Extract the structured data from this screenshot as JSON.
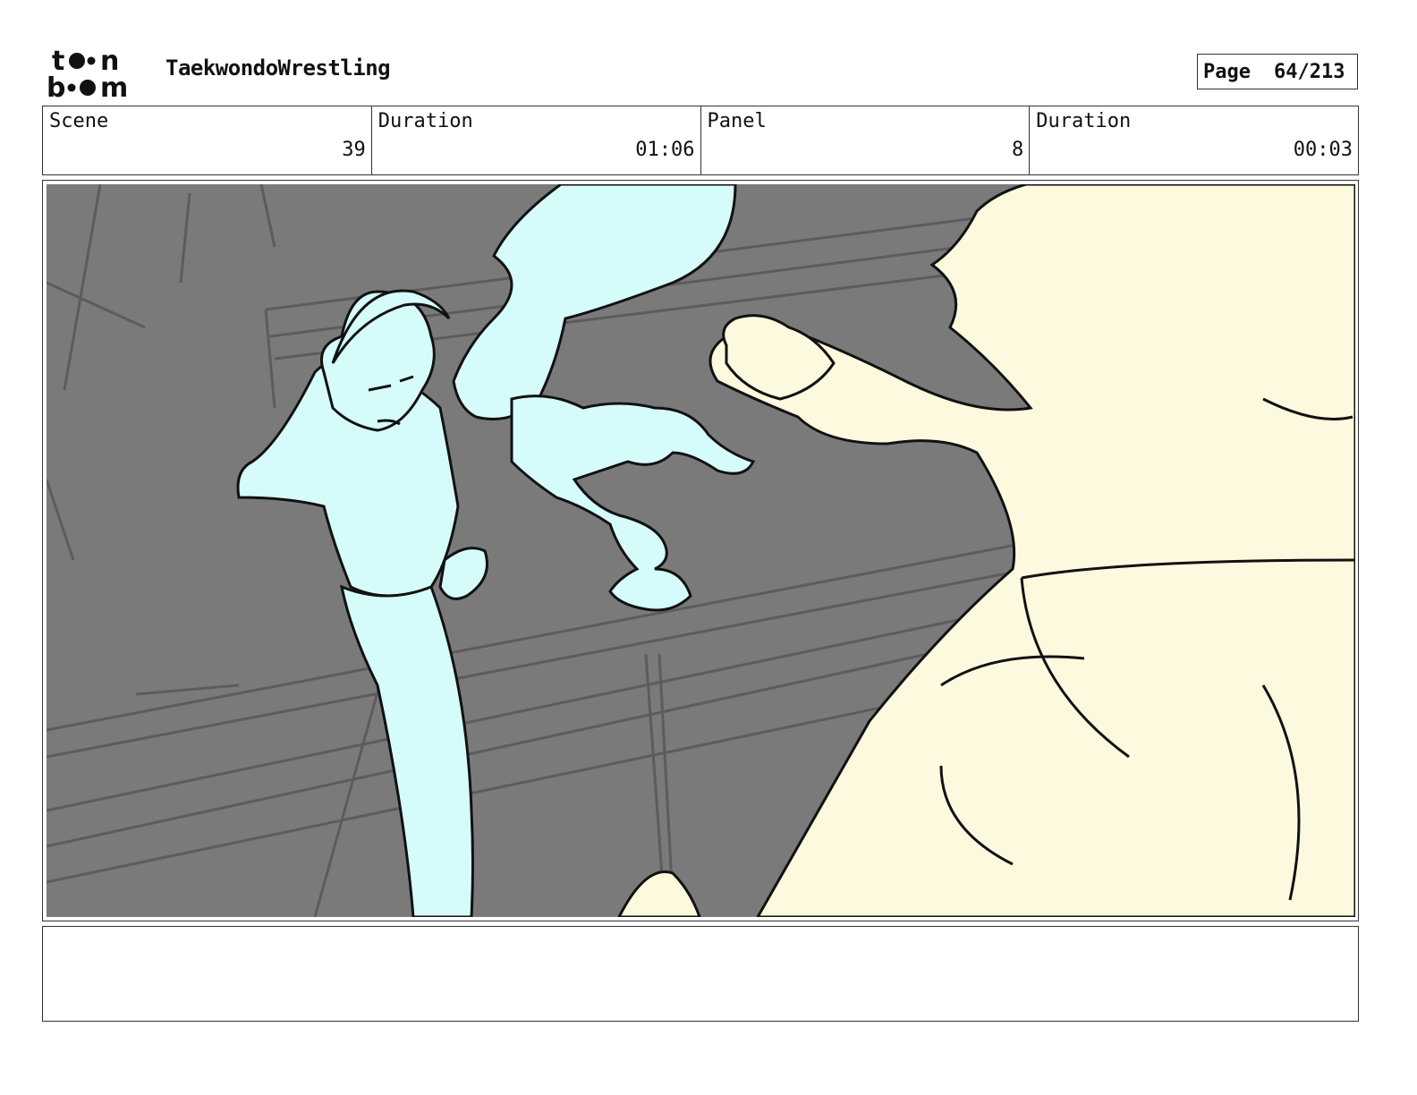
{
  "header": {
    "logo_top": "to",
    "logo_top_end": "n",
    "logo_bottom": "b",
    "logo_bottom_end": "m",
    "project_title": "TaekwondoWrestling",
    "page_label": "Page",
    "page_value": "64/213"
  },
  "info": {
    "scene_label": "Scene",
    "scene_value": "39",
    "scene_duration_label": "Duration",
    "scene_duration_value": "01:06",
    "panel_label": "Panel",
    "panel_value": "8",
    "panel_duration_label": "Duration",
    "panel_duration_value": "00:03"
  },
  "panel": {
    "background_color": "#7a7a7a",
    "left_character_color": "#d6fbfb",
    "right_character_color": "#fdf9df",
    "line_color": "#111111"
  },
  "notes": {
    "text": ""
  }
}
